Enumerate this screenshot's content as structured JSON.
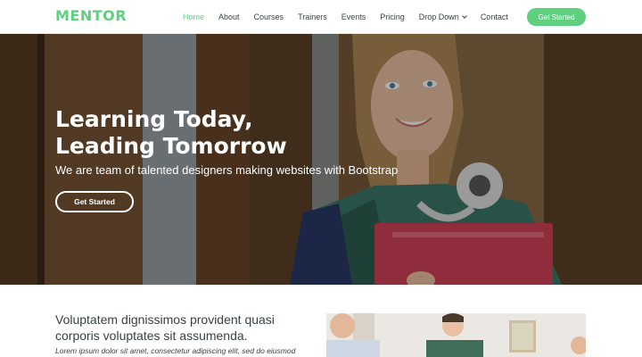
{
  "header": {
    "logo": "MENTOR",
    "nav": [
      "Home",
      "About",
      "Courses",
      "Trainers",
      "Events",
      "Pricing",
      "Drop Down",
      "Contact"
    ],
    "active_nav": "Home",
    "cta": "Get Started"
  },
  "hero": {
    "title_line1": "Learning Today,",
    "title_line2": "Leading Tomorrow",
    "subtitle": "We are team of talented designers making websites with Bootstrap",
    "button": "Get Started"
  },
  "about": {
    "heading": "Voluptatem dignissimos provident quasi corporis voluptates sit assumenda.",
    "text": "Lorem ipsum dolor sit amet, consectetur adipiscing elit, sed do eiusmod"
  },
  "colors": {
    "accent": "#5fcf80",
    "text": "#37423b"
  },
  "icons": {
    "dropdown": "chevron-down-icon"
  }
}
